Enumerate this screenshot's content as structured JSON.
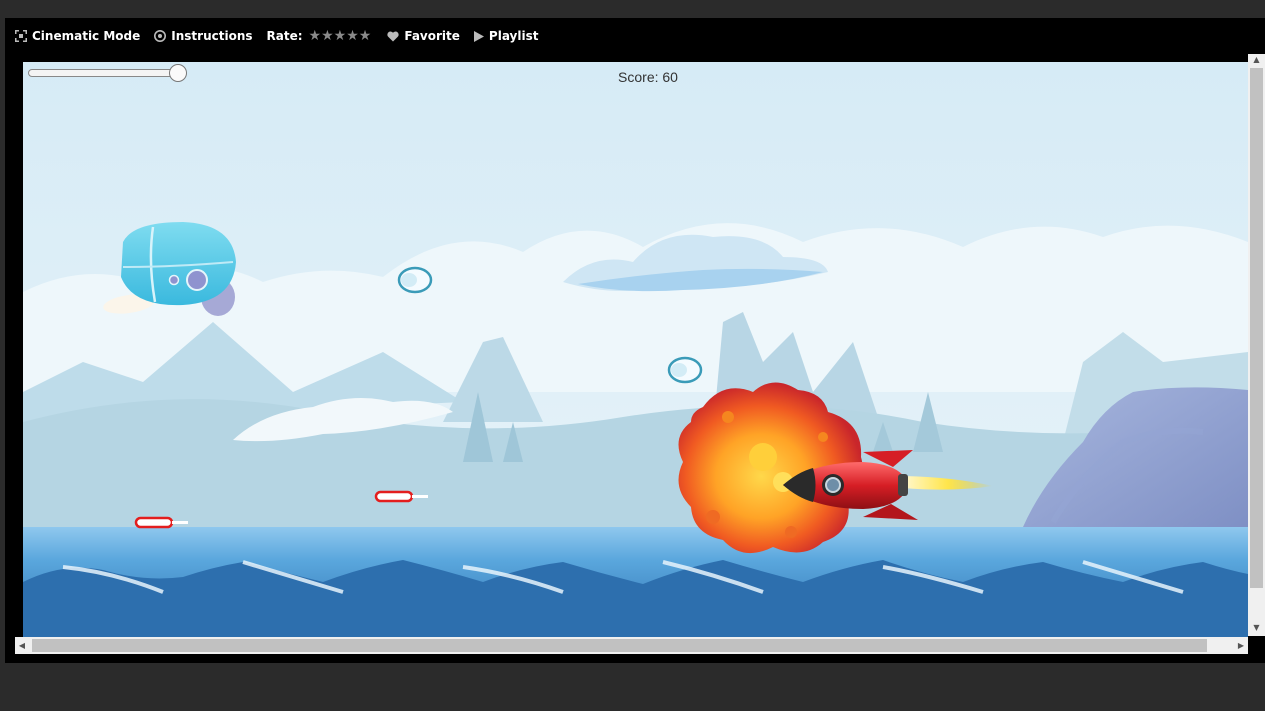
{
  "toolbar": {
    "cinematic_label": "Cinematic Mode",
    "instructions_label": "Instructions",
    "rate_label": "Rate:",
    "stars": [
      "★",
      "★",
      "★",
      "★",
      "★"
    ],
    "favorite_label": "Favorite",
    "playlist_label": "Playlist"
  },
  "game": {
    "score_text": "Score: 60",
    "volume_level": 1.0
  },
  "icons": {
    "cinematic": "expand-icon",
    "instructions": "instructions-icon",
    "favorite": "heart-icon",
    "playlist": "play-icon"
  },
  "colors": {
    "toolbar_bg": "#000000",
    "star_gray": "#8a8a8a",
    "sky": "#d8ecf6",
    "water": "#3d8ccc",
    "rocket_red": "#d61e25"
  }
}
